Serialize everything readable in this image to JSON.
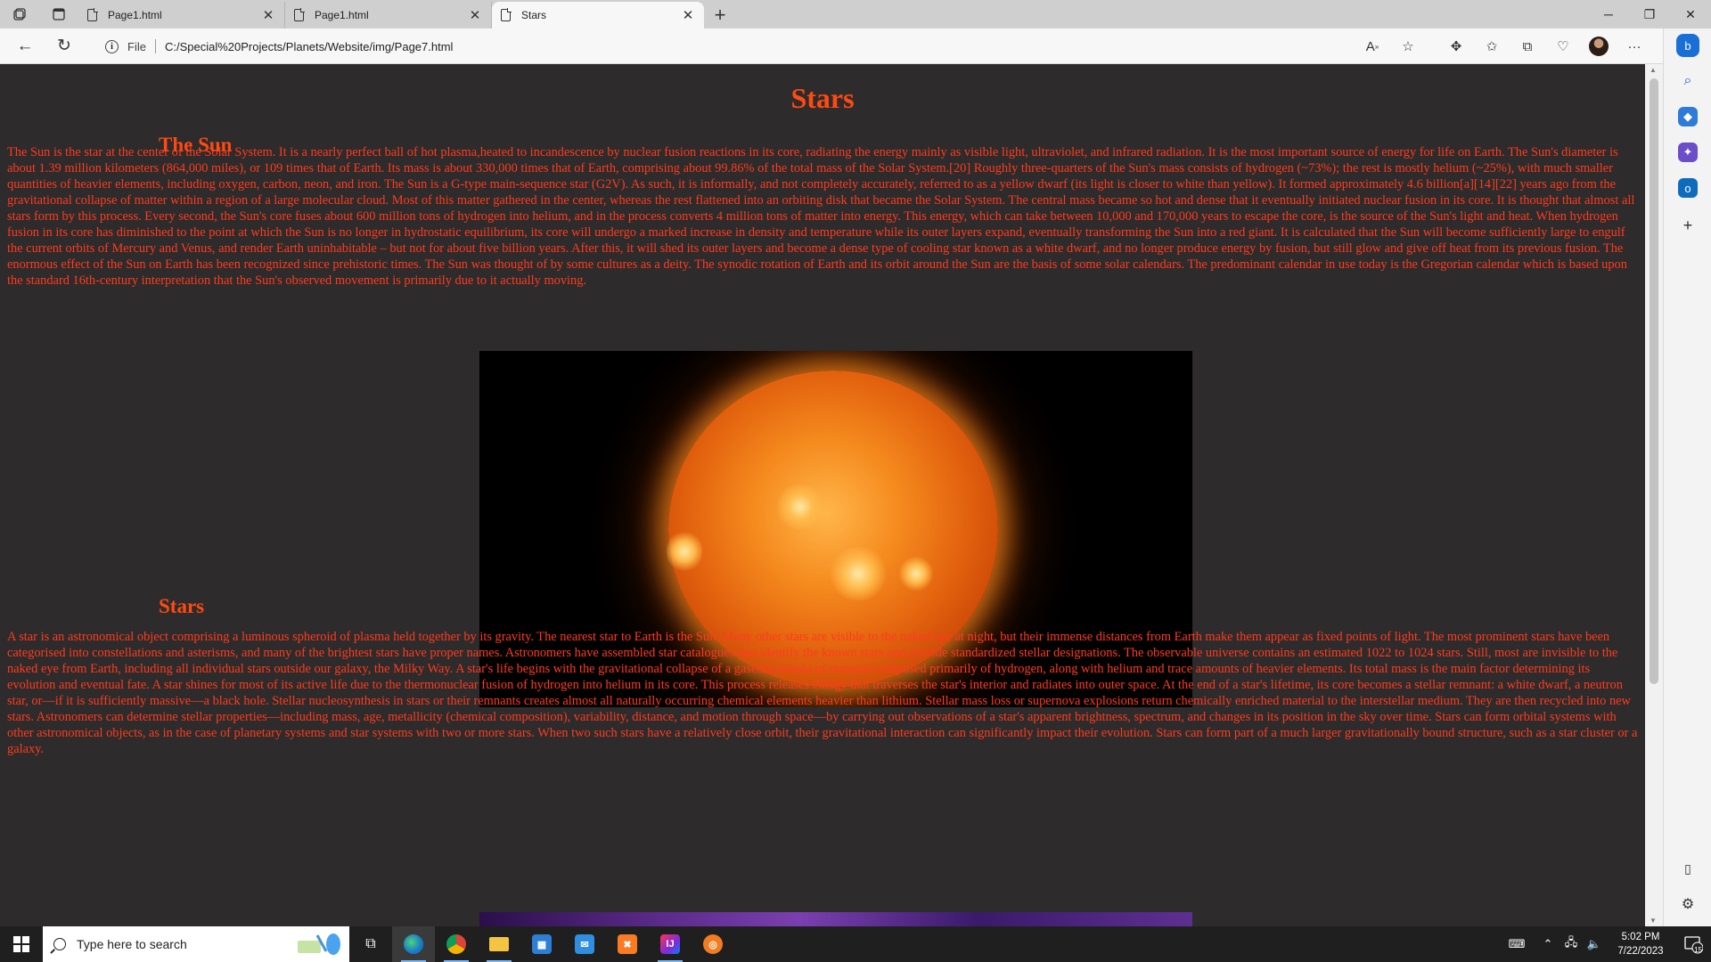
{
  "browser": {
    "tabs": [
      {
        "label": "Page1.html"
      },
      {
        "label": "Page1.html"
      },
      {
        "label": "Stars"
      }
    ],
    "new_tab_icon": "plus-icon",
    "window_controls": {
      "minimize": "─",
      "restore": "❐",
      "close": "✕"
    }
  },
  "address_bar": {
    "scheme": "File",
    "url": "C:/Special%20Projects/Planets/Website/img/Page7.html"
  },
  "page": {
    "title": "Stars",
    "sections": [
      {
        "heading": "The Sun",
        "text": "The Sun is the star at the center of the Solar System. It is a nearly perfect ball of hot plasma,heated to incandescence by nuclear fusion reactions in its core, radiating the energy mainly as visible light, ultraviolet, and infrared radiation. It is the most important source of energy for life on Earth. The Sun's diameter is about 1.39 million kilometers (864,000 miles), or 109 times that of Earth. Its mass is about 330,000 times that of Earth, comprising about 99.86% of the total mass of the Solar System.[20] Roughly three-quarters of the Sun's mass consists of hydrogen (~73%); the rest is mostly helium (~25%), with much smaller quantities of heavier elements, including oxygen, carbon, neon, and iron. The Sun is a G-type main-sequence star (G2V). As such, it is informally, and not completely accurately, referred to as a yellow dwarf (its light is closer to white than yellow). It formed approximately 4.6 billion[a][14][22] years ago from the gravitational collapse of matter within a region of a large molecular cloud. Most of this matter gathered in the center, whereas the rest flattened into an orbiting disk that became the Solar System. The central mass became so hot and dense that it eventually initiated nuclear fusion in its core. It is thought that almost all stars form by this process. Every second, the Sun's core fuses about 600 million tons of hydrogen into helium, and in the process converts 4 million tons of matter into energy. This energy, which can take between 10,000 and 170,000 years to escape the core, is the source of the Sun's light and heat. When hydrogen fusion in its core has diminished to the point at which the Sun is no longer in hydrostatic equilibrium, its core will undergo a marked increase in density and temperature while its outer layers expand, eventually transforming the Sun into a red giant. It is calculated that the Sun will become sufficiently large to engulf the current orbits of Mercury and Venus, and render Earth uninhabitable – but not for about five billion years. After this, it will shed its outer layers and become a dense type of cooling star known as a white dwarf, and no longer produce energy by fusion, but still glow and give off heat from its previous fusion. The enormous effect of the Sun on Earth has been recognized since prehistoric times. The Sun was thought of by some cultures as a deity. The synodic rotation of Earth and its orbit around the Sun are the basis of some solar calendars. The predominant calendar in use today is the Gregorian calendar which is based upon the standard 16th-century interpretation that the Sun's observed movement is primarily due to it actually moving."
      },
      {
        "heading": "Stars",
        "text": "A star is an astronomical object comprising a luminous spheroid of plasma held together by its gravity. The nearest star to Earth is the Sun. Many other stars are visible to the naked eye at night, but their immense distances from Earth make them appear as fixed points of light. The most prominent stars have been categorised into constellations and asterisms, and many of the brightest stars have proper names. Astronomers have assembled star catalogues that identify the known stars and provide standardized stellar designations. The observable universe contains an estimated 1022 to 1024 stars. Still, most are invisible to the naked eye from Earth, including all individual stars outside our galaxy, the Milky Way. A star's life begins with the gravitational collapse of a gaseous nebula of material composed primarily of hydrogen, along with helium and trace amounts of heavier elements. Its total mass is the main factor determining its evolution and eventual fate. A star shines for most of its active life due to the thermonuclear fusion of hydrogen into helium in its core. This process releases energy that traverses the star's interior and radiates into outer space. At the end of a star's lifetime, its core becomes a stellar remnant: a white dwarf, a neutron star, or—if it is sufficiently massive—a black hole. Stellar nucleosynthesis in stars or their remnants creates almost all naturally occurring chemical elements heavier than lithium. Stellar mass loss or supernova explosions return chemically enriched material to the interstellar medium. They are then recycled into new stars. Astronomers can determine stellar properties—including mass, age, metallicity (chemical composition), variability, distance, and motion through space—by carrying out observations of a star's apparent brightness, spectrum, and changes in its position in the sky over time. Stars can form orbital systems with other astronomical objects, as in the case of planetary systems and star systems with two or more stars. When two such stars have a relatively close orbit, their gravitational interaction can significantly impact their evolution. Stars can form part of a much larger gravitationally bound structure, such as a star cluster or a galaxy."
      }
    ],
    "colors": {
      "text": "#ff3b1f",
      "heading": "#ff4a12",
      "background": "#2d2b2b"
    }
  },
  "taskbar": {
    "search_placeholder": "Type here to search",
    "time": "5:02 PM",
    "date": "7/22/2023",
    "notification_count": "15"
  }
}
